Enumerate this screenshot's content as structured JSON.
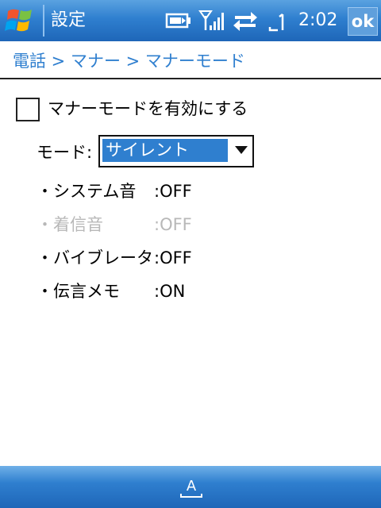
{
  "titlebar": {
    "title": "設定",
    "clock": "2:02",
    "ok_label": "ok",
    "icons": [
      "windows-start-icon",
      "battery-icon",
      "signal-icon",
      "sync-icon",
      "connection-icon"
    ]
  },
  "breadcrumb": "電話 > マナー > マナーモード",
  "checkbox": {
    "label": "マナーモードを有効にする",
    "checked": false
  },
  "mode": {
    "label": "モード:",
    "selected": "サイレント"
  },
  "items": [
    {
      "name": "・システム音",
      "value": ":OFF",
      "enabled": true
    },
    {
      "name": "・着信音",
      "value": ":OFF",
      "enabled": false
    },
    {
      "name": "・バイブレータ",
      "value": ":OFF",
      "enabled": true
    },
    {
      "name": "・伝言メモ",
      "value": ":ON",
      "enabled": true
    }
  ],
  "colors": {
    "accent": "#2f7fcf",
    "disabled": "#b8b8b8"
  }
}
